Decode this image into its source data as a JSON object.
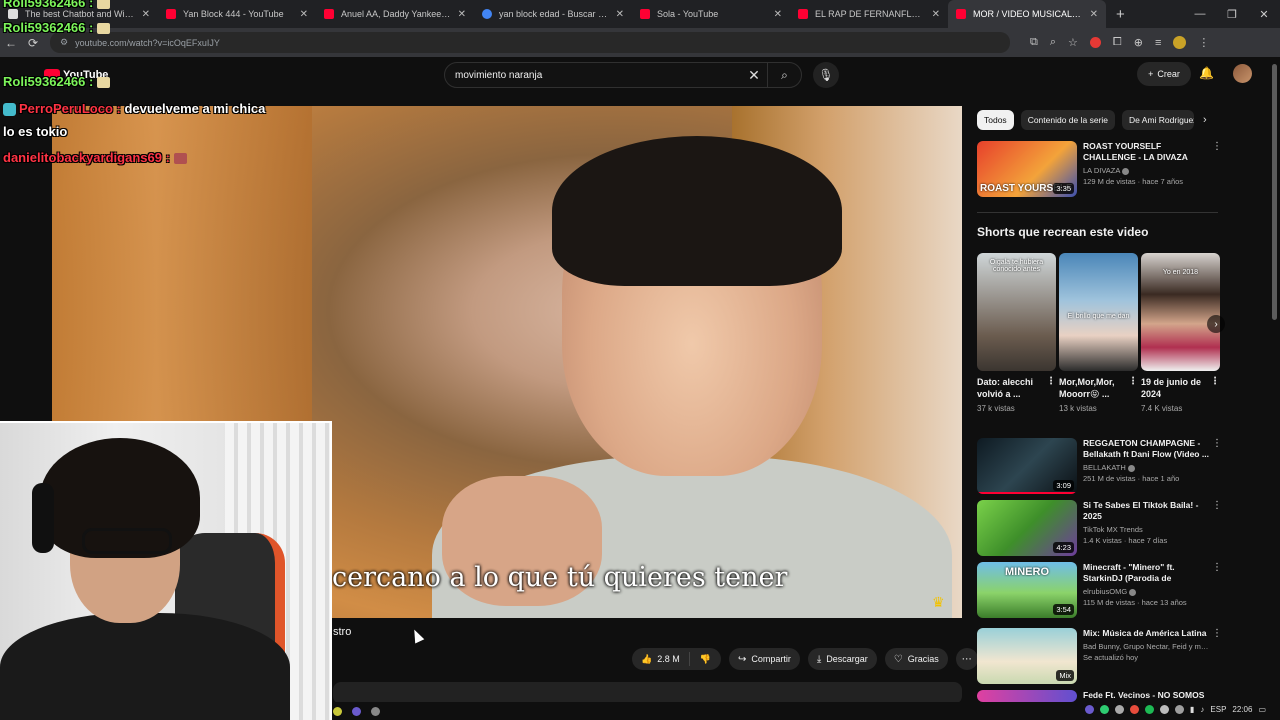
{
  "browser": {
    "tabs": [
      {
        "title": "The best Chatbot and Widgets"
      },
      {
        "title": "Yan Block 444 - YouTube"
      },
      {
        "title": "Anuel AA, Daddy Yankee, Karol"
      },
      {
        "title": "yan block edad - Buscar con Google"
      },
      {
        "title": "Sola - YouTube"
      },
      {
        "title": "EL RAP DE FERNANFLOO !! - YouTube"
      },
      {
        "title": "MOR / VIDEO MUSICAL - AMI"
      }
    ],
    "url": "youtube.com/watch?v=icOqEFxuIJY"
  },
  "youtube": {
    "logo": "YouTube",
    "search": {
      "value": "movimiento naranja",
      "placeholder": "Buscar"
    },
    "create_label": "Crear"
  },
  "video": {
    "subtitle": "cercano a lo que tú quieres tener",
    "title_fragment": "stro",
    "actions": {
      "likes": "2.8 M",
      "share": "Compartir",
      "download": "Descargar",
      "thanks": "Gracias"
    }
  },
  "sidebar": {
    "chips": [
      "Todos",
      "Contenido de la serie",
      "De Ami Rodriguez"
    ],
    "top_video": {
      "title": "ROAST YOURSELF CHALLENGE - LA DIVAZA",
      "channel": "LA DIVAZA",
      "meta": "129 M de vistas · hace 7 años",
      "duration": "3:35",
      "thumb_text": "ROAST YOURSELF"
    },
    "shorts_heading": "Shorts que recrean este video",
    "shorts": [
      {
        "title": "Dato: alecchi volvió a ...",
        "views": "37 k vistas",
        "caption": "Oigala te hubiera conocido antes"
      },
      {
        "title": "Mor,Mor,Mor, Mooorr😝 ...",
        "views": "13 k vistas",
        "caption": "El brillo que me dan"
      },
      {
        "title": "19 de junio de 2024",
        "views": "7.4 K vistas",
        "caption": "Yo en 2018"
      }
    ],
    "videos": [
      {
        "title": "REGGAETON CHAMPAGNE - Bellakath ft Dani Flow (Video ...",
        "channel": "BELLAKATH",
        "meta": "251 M de vistas · hace 1 año",
        "duration": "3:09"
      },
      {
        "title": "Si Te Sabes El Tiktok Baila! - 2025",
        "channel": "TikTok MX Trends",
        "meta": "1.4 K vistas · hace 7 días",
        "duration": "4:23"
      },
      {
        "title": "Minecraft - \"Minero\" ft. StarkinDJ (Parodia de \"Torero\"...",
        "channel": "elrubiusOMG",
        "meta": "115 M de vistas · hace 13 años",
        "duration": "3:54",
        "thumb_text": "MINERO"
      },
      {
        "title": "Mix: Música de América Latina",
        "channel": "Bad Bunny, Grupo Nectar, Feid y muchos ...",
        "meta": "Se actualizó hoy",
        "duration": "Mix"
      },
      {
        "title": "Fede Ft. Vecinos - NO SOMOS",
        "channel": "",
        "meta": "",
        "duration": ""
      }
    ]
  },
  "stream_chat": [
    {
      "user": "Roli59362466 :",
      "message": ""
    },
    {
      "user": "Roli59362466 :",
      "message": ""
    },
    {
      "user": "Roli59362466 :",
      "message": ""
    },
    {
      "user": "PerroPeruLoco :",
      "message": "devuelveme a mi chica"
    },
    {
      "user": "",
      "message": "lo es tokio"
    },
    {
      "user": "danielitobackyardigans69 :",
      "message": ""
    }
  ],
  "taskbar": {
    "lang": "ESP",
    "time": "22:06"
  }
}
